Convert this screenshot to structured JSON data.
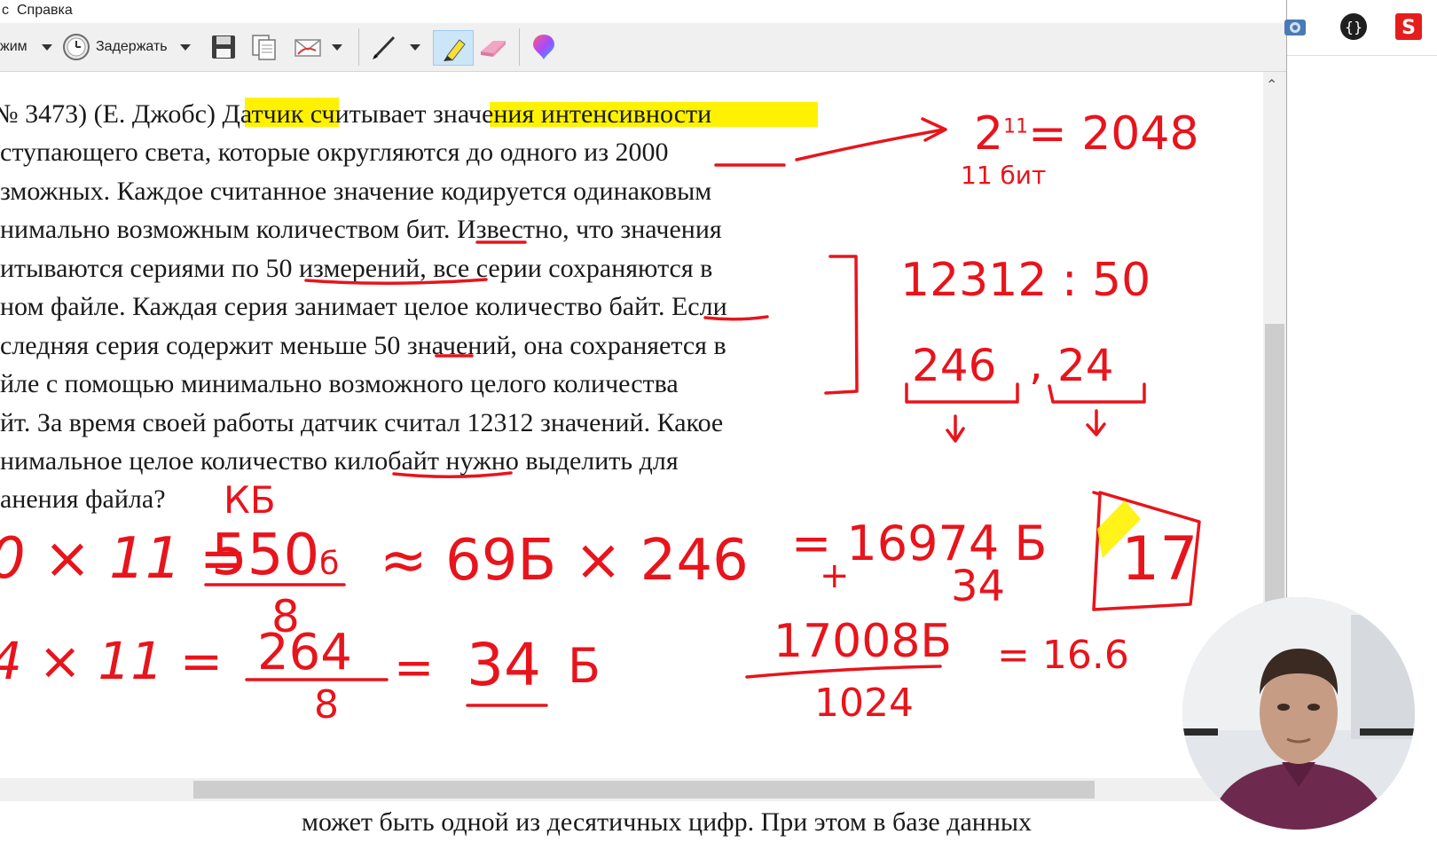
{
  "menubar": {
    "items": [
      "с",
      "Справка"
    ]
  },
  "toolbar": {
    "mode_label": "жим",
    "delay_label": "Задержать"
  },
  "document": {
    "lines": [
      {
        "pre": "№ 3473) (Е. Джобс) ",
        "hl1": "Датчик",
        "mid": " считывает ",
        "hl2": "значения интенсивности",
        "post": ""
      },
      {
        "text": "ступающего света, которые округляются до одного из 2000"
      },
      {
        "text": "зможных. Каждое считанное значение кодируется одинаковым"
      },
      {
        "text": "нимально возможным количеством бит. Известно, что значения"
      },
      {
        "text": "итываются сериями по 50 измерений, все серии сохраняются в"
      },
      {
        "text": "ном файле. Каждая серия занимает целое количество байт. Если"
      },
      {
        "text": "следняя серия содержит меньше 50 значений, она сохраняется в"
      },
      {
        "text": "йле с помощью минимально возможного целого количества"
      },
      {
        "text": "йт. За время своей работы датчик считал 12312 значений. Какое"
      },
      {
        "text": "нимальное целое количество килобайт нужно выделить для"
      },
      {
        "text": "анения файла?"
      }
    ]
  },
  "handwriting": {
    "pow": "2",
    "pow_exp": "11",
    "pow_result": "= 2048",
    "bits": "11 бит",
    "division": "12312 : 50",
    "quotient": "246",
    "remainder": "24",
    "kb_note": "КБ",
    "line1_left": "0 × 11 =",
    "line1_frac_num": "550",
    "line1_frac_unit": "б",
    "line1_frac_den": "8",
    "line1_approx": "≈ 69Б × 246",
    "line1_eq": "= 16974 Б",
    "line1_plus": "+",
    "line1_add": "34",
    "answer": "17",
    "line2_left": "4 × 11 =",
    "line2_frac_num": "264",
    "line2_frac_den": "8",
    "line2_eq": "=",
    "line2_result": "34",
    "line2_unit": "Б",
    "total_num": "17008Б",
    "total_den": "1024",
    "total_result": "= 16.6"
  },
  "bottom_text": "может быть одной из десятичных цифр. При этом в базе данных",
  "colors": {
    "ink": "#e8141c",
    "highlight": "#fff200",
    "toolbar_bg": "#f0f0f0"
  },
  "icons": [
    "clock-icon",
    "save-icon",
    "copy-icon",
    "send-icon",
    "pen-icon",
    "highlighter-icon",
    "eraser-icon",
    "paint3d-icon",
    "camera-icon",
    "braces-icon",
    "s-app-icon"
  ]
}
